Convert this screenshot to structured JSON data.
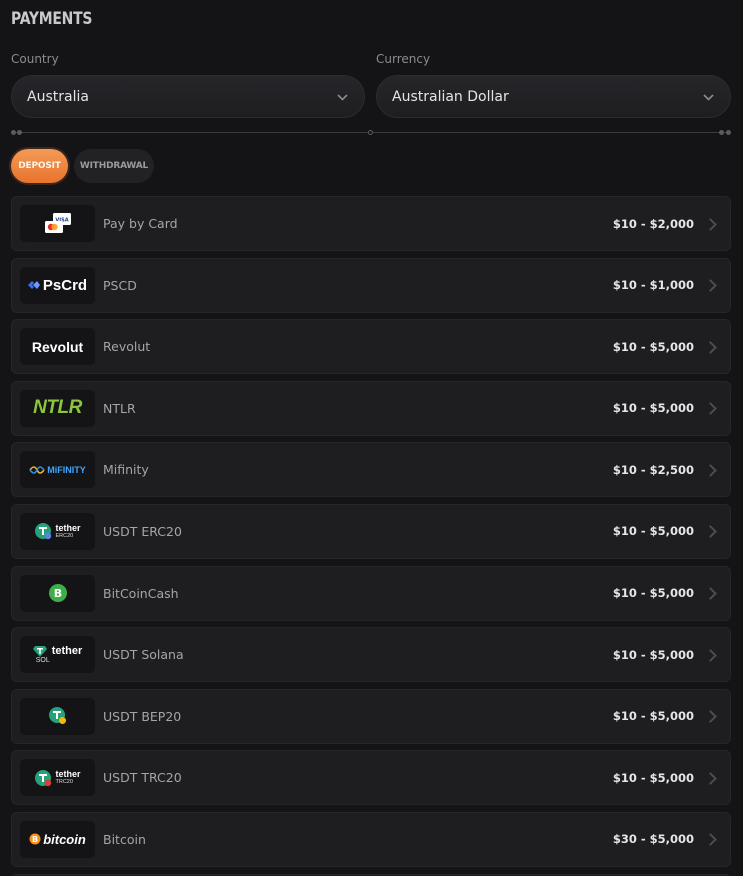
{
  "page": {
    "title": "PAYMENTS"
  },
  "country": {
    "label": "Country",
    "value": "Australia"
  },
  "currency": {
    "label": "Currency",
    "value": "Australian Dollar"
  },
  "tabs": {
    "deposit": "DEPOSIT",
    "withdrawal": "WITHDRAWAL",
    "active": "deposit"
  },
  "accent": "#ee8442",
  "methods": [
    {
      "name": "Pay by Card",
      "limits": "$10 - $2,000",
      "icon": "card-icon"
    },
    {
      "name": "PSCD",
      "limits": "$10 - $1,000",
      "icon": "pscrd-logo",
      "logo_text": "PsCrd"
    },
    {
      "name": "Revolut",
      "limits": "$10 - $5,000",
      "icon": "revolut-logo",
      "logo_text": "Revolut"
    },
    {
      "name": "NTLR",
      "limits": "$10 - $5,000",
      "icon": "ntlr-logo",
      "logo_text": "NTLR"
    },
    {
      "name": "Mifinity",
      "limits": "$10 - $2,500",
      "icon": "mifinity-logo",
      "logo_text": "MiFINITY"
    },
    {
      "name": "USDT ERC20",
      "limits": "$10 - $5,000",
      "icon": "tether-erc20-logo",
      "logo_text": "tether",
      "logo_sub": "ERC20"
    },
    {
      "name": "BitCoinCash",
      "limits": "$10 - $5,000",
      "icon": "bitcoincash-icon"
    },
    {
      "name": "USDT Solana",
      "limits": "$10 - $5,000",
      "icon": "tether-sol-logo",
      "logo_text": "tether",
      "logo_sub": "SOL"
    },
    {
      "name": "USDT BEP20",
      "limits": "$10 - $5,000",
      "icon": "tether-bep20-icon"
    },
    {
      "name": "USDT TRC20",
      "limits": "$10 - $5,000",
      "icon": "tether-trc20-logo",
      "logo_text": "tether",
      "logo_sub": "TRC20"
    },
    {
      "name": "Bitcoin",
      "limits": "$30 - $5,000",
      "icon": "bitcoin-logo",
      "logo_text": "bitcoin"
    }
  ]
}
